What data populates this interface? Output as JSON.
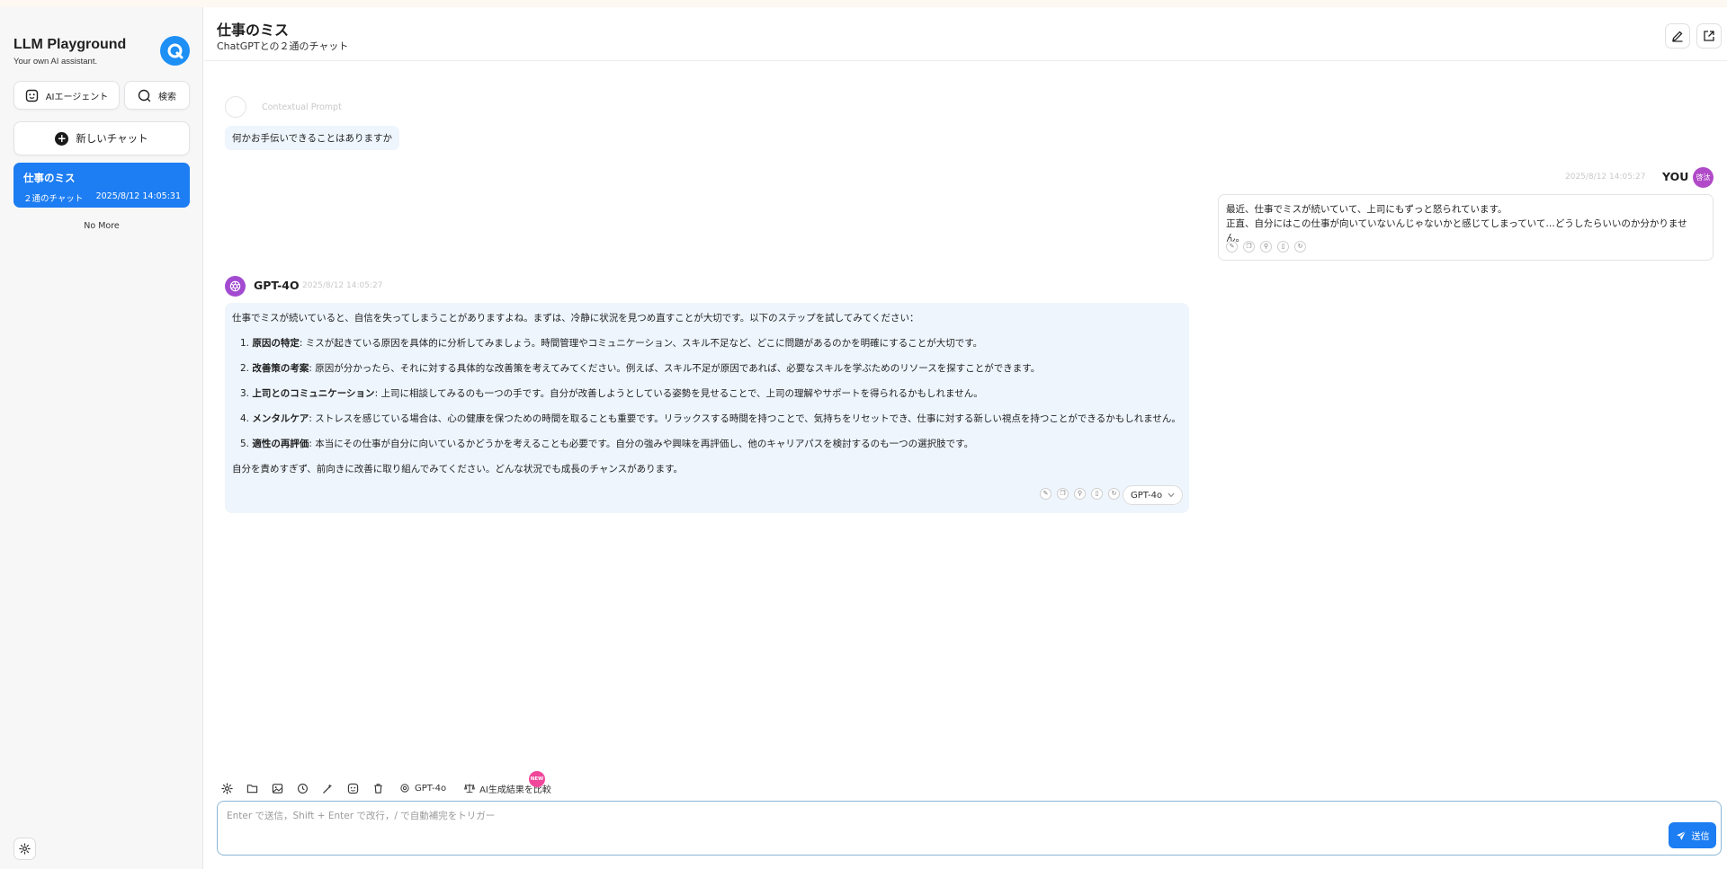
{
  "app": {
    "title": "LLM Playground",
    "subtitle": "Your own AI assistant."
  },
  "sidebar": {
    "agent_label": "AIエージェント",
    "search_label": "検索",
    "new_chat_label": "新しいチャット",
    "chats": [
      {
        "title": "仕事のミス",
        "count": "２通のチャット",
        "date": "2025/8/12 14:05:31"
      }
    ],
    "no_more": "No More"
  },
  "header": {
    "title": "仕事のミス",
    "subtitle": "ChatGPTとの２通のチャット"
  },
  "messages": {
    "context_label": "Contextual Prompt",
    "context_text": "何かお手伝いできることはありますか",
    "user": {
      "label": "YOU",
      "avatar_text": "啓汰",
      "date": "2025/8/12 14:05:27",
      "lines": [
        "最近、仕事でミスが続いていて、上司にもずっと怒られています。",
        "正直、自分にはこの仕事が向いていないんじゃないかと感じてしまっていて…どうしたらいいのか分かりません。"
      ]
    },
    "bot": {
      "label": "GPT-4O",
      "date": "2025/8/12 14:05:27",
      "intro": "仕事でミスが続いていると、自信を失ってしまうことがありますよね。まずは、冷静に状況を見つめ直すことが大切です。以下のステップを試してみてください：",
      "steps": [
        {
          "num": "1.",
          "title": "原因の特定",
          "text": ": ミスが起きている原因を具体的に分析してみましょう。時間管理やコミュニケーション、スキル不足など、どこに問題があるのかを明確にすることが大切です。"
        },
        {
          "num": "2.",
          "title": "改善策の考案",
          "text": ": 原因が分かったら、それに対する具体的な改善策を考えてみてください。例えば、スキル不足が原因であれば、必要なスキルを学ぶためのリソースを探すことができます。"
        },
        {
          "num": "3.",
          "title": "上司とのコミュニケーション",
          "text": ": 上司に相談してみるのも一つの手です。自分が改善しようとしている姿勢を見せることで、上司の理解やサポートを得られるかもしれません。"
        },
        {
          "num": "4.",
          "title": "メンタルケア",
          "text": ": ストレスを感じている場合は、心の健康を保つための時間を取ることも重要です。リラックスする時間を持つことで、気持ちをリセットでき、仕事に対する新しい視点を持つことができるかもしれません。"
        },
        {
          "num": "5.",
          "title": "適性の再評価",
          "text": ": 本当にその仕事が自分に向いているかどうかを考えることも必要です。自分の強みや興味を再評価し、他のキャリアパスを検討するのも一つの選択肢です。"
        }
      ],
      "outro": "自分を責めすぎず、前向きに改善に取り組んでみてください。どんな状況でも成長のチャンスがあります。",
      "model": "GPT-4o"
    }
  },
  "composer": {
    "model_chip": "GPT-4o",
    "compare_chip": "AI生成結果を比較",
    "new_badge": "NEW",
    "placeholder": "Enter で送信，Shift + Enter で改行，/ で自動補完をトリガー",
    "send_label": "送信"
  },
  "colors": {
    "accent": "#1d7df2",
    "bot_bubble": "#eef5fd",
    "user_avatar": "#b04ac8",
    "gpt_avatar": "#a24bd1",
    "new_badge": "#f0479b"
  }
}
